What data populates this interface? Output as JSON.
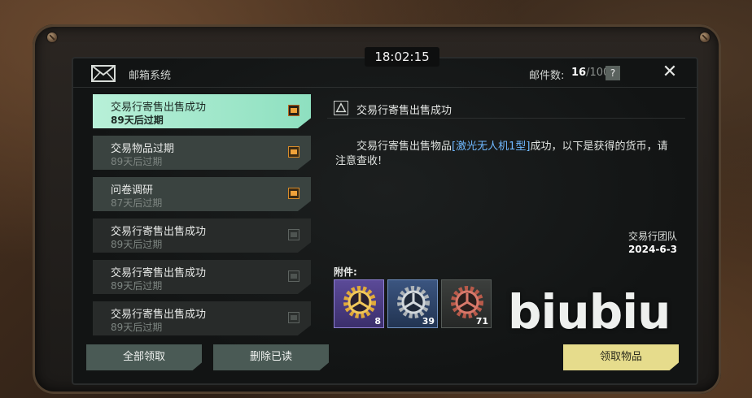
{
  "colors": {
    "accent_selected": "#9ee6c8",
    "attachment_orange": "#f0a23a",
    "link_blue": "#6fb8ff",
    "claim_button": "#e6dc8c"
  },
  "clock": "18:02:15",
  "header": {
    "icon": "mail-icon",
    "title": "邮箱系统",
    "mail_count_label": "邮件数:",
    "mail_count_current": "16",
    "mail_count_max": "/100",
    "help": "?",
    "close_icon": "close-icon"
  },
  "mail_list": [
    {
      "subject": "交易行寄售出售成功",
      "expiry": "89天后过期",
      "state": "selected",
      "attachment": "active"
    },
    {
      "subject": "交易物品过期",
      "expiry": "89天后过期",
      "state": "unread",
      "attachment": "active"
    },
    {
      "subject": "问卷调研",
      "expiry": "87天后过期",
      "state": "unread",
      "attachment": "active"
    },
    {
      "subject": "交易行寄售出售成功",
      "expiry": "89天后过期",
      "state": "read",
      "attachment": "claimed"
    },
    {
      "subject": "交易行寄售出售成功",
      "expiry": "89天后过期",
      "state": "read",
      "attachment": "claimed"
    },
    {
      "subject": "交易行寄售出售成功",
      "expiry": "89天后过期",
      "state": "read",
      "attachment": "claimed"
    }
  ],
  "detail": {
    "title": "交易行寄售出售成功",
    "body_prefix": "交易行寄售出售物品",
    "item_link": "[激光无人机1型]",
    "body_suffix": "成功，以下是获得的货币，请注意查收!",
    "sender": "交易行团队",
    "date": "2024-6-3",
    "attachments_label": "附件:",
    "attachments": [
      {
        "icon": "gold-gear-icon",
        "quantity": "8",
        "rarity": "purple"
      },
      {
        "icon": "silver-gear-icon",
        "quantity": "39",
        "rarity": "blue"
      },
      {
        "icon": "copper-gear-icon",
        "quantity": "71",
        "rarity": "gray"
      }
    ]
  },
  "buttons": {
    "claim_all": "全部领取",
    "delete_read": "删除已读",
    "claim_items": "领取物品"
  },
  "watermark": "biubiu"
}
